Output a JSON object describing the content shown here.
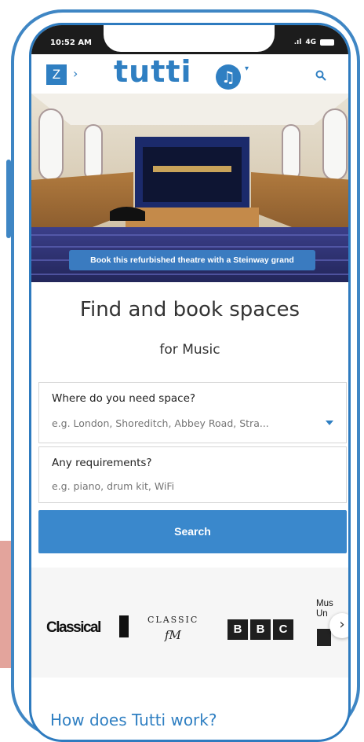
{
  "status": {
    "time": "10:52 AM",
    "network": "4G"
  },
  "header": {
    "z_label": "Z",
    "logo_text": "tutti",
    "note_icon": "music-note-icon",
    "search_icon": "search-icon"
  },
  "hero": {
    "caption": "Book this refurbished theatre with a Steinway grand"
  },
  "main": {
    "title": "Find and book spaces",
    "subtitle": "for Music"
  },
  "form": {
    "where_label": "Where do you need space?",
    "where_placeholder": "e.g. London, Shoreditch, Abbey Road, Stra...",
    "req_label": "Any requirements?",
    "req_placeholder": "e.g. piano, drum kit, WiFi",
    "search_button": "Search"
  },
  "partners": {
    "classical": "Classical",
    "classicfm_top": "CLASSIC",
    "classicfm_bottom": "fM",
    "bbc": [
      "B",
      "B",
      "C"
    ],
    "mu": "Mus\nUn"
  },
  "footer_heading": "How does Tutti work?",
  "colors": {
    "accent": "#2f7fc2",
    "button": "#3a88cc",
    "frame": "#3f86c4",
    "side_block": "#e3a49c"
  }
}
